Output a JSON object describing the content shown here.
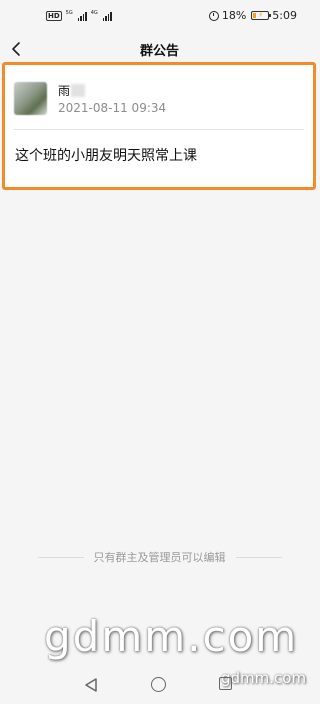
{
  "status_bar": {
    "hd": "HD",
    "net1": "5G",
    "net2": "4G",
    "battery": "18%",
    "time": "5:09"
  },
  "header": {
    "title": "群公告"
  },
  "announcement": {
    "author": "雨",
    "time": "2021-08-11 09:34",
    "content": "这个班的小朋友明天照常上课"
  },
  "footer": {
    "note": "只有群主及管理员可以编辑"
  },
  "watermark": {
    "large": "gdmm.com",
    "small": "gdmm.com"
  },
  "colors": {
    "highlight": "#f58a2b",
    "background": "#f5f5f5"
  }
}
